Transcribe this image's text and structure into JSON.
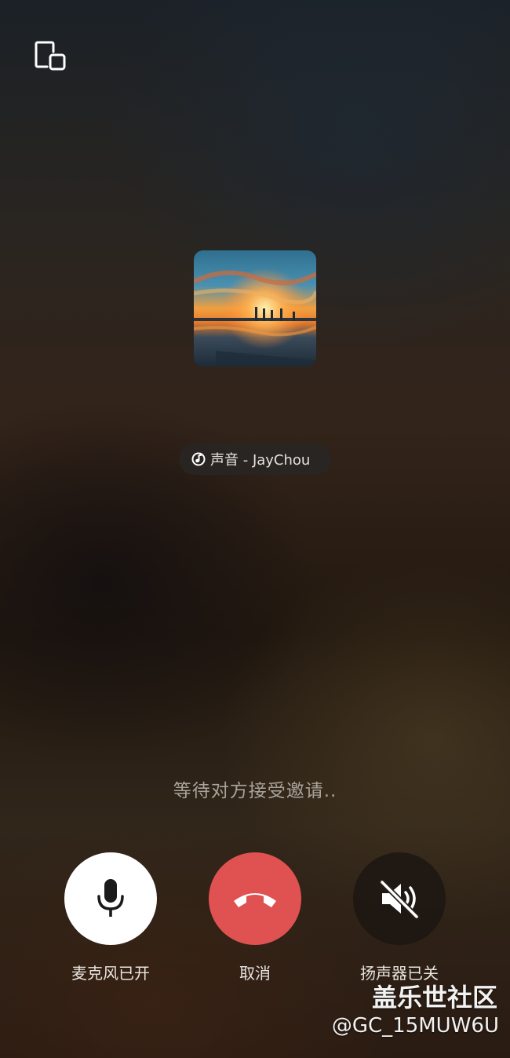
{
  "call": {
    "status_text": "等待对方接受邀请..",
    "music_chip_text": "声音 - JayChou"
  },
  "controls": [
    {
      "name": "microphone",
      "label": "麦克风已开",
      "icon": "microphone-icon",
      "state": "on",
      "color": "#ffffff"
    },
    {
      "name": "hang-up",
      "label": "取消",
      "icon": "phone-hangup-icon",
      "color": "#e05252"
    },
    {
      "name": "speaker",
      "label": "扬声器已关",
      "icon": "speaker-muted-icon",
      "state": "off"
    }
  ],
  "icons": {
    "top_left": "picture-in-picture-icon",
    "music": "music-note-icon"
  },
  "watermark": {
    "title": "盖乐世社区",
    "user": "@GC_15MUW6U"
  }
}
